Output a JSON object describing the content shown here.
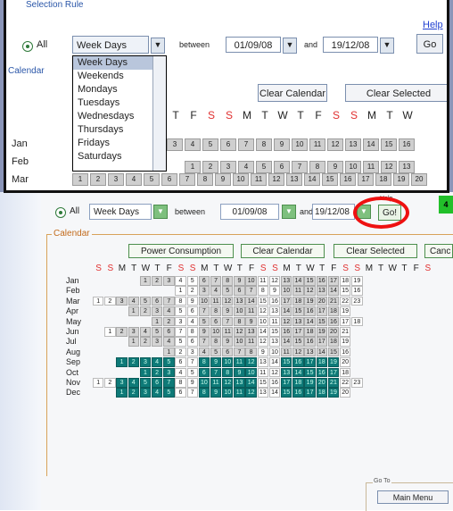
{
  "inset": {
    "title": "Selection Rule",
    "help": "Help",
    "all_label": "All",
    "select_value": "Week Days",
    "between": "between",
    "date_from": "01/09/08",
    "and": "and",
    "date_to": "19/12/08",
    "go": "Go",
    "calendar_label": "Calendar",
    "dropdown_options": [
      "Week Days",
      "Weekends",
      "Mondays",
      "Tuesdays",
      "Wednesdays",
      "Thursdays",
      "Fridays",
      "Saturdays"
    ],
    "clear_calendar": "Clear Calendar",
    "clear_selected": "Clear Selected",
    "day_header": [
      "T",
      "F",
      "S",
      "S",
      "M",
      "T",
      "W",
      "T",
      "F",
      "S",
      "S",
      "M",
      "T",
      "W"
    ],
    "months": [
      "Jan",
      "Feb",
      "Mar"
    ],
    "jan_cells": [
      "3",
      "4",
      "5",
      "6",
      "7",
      "8",
      "9",
      "10",
      "11",
      "12",
      "13",
      "14",
      "15",
      "16"
    ],
    "feb_cells": [
      "",
      "1",
      "2",
      "3",
      "4",
      "5",
      "6",
      "7",
      "8",
      "9",
      "10",
      "11",
      "12",
      "13"
    ],
    "mar_cells": [
      "1",
      "2",
      "3",
      "4",
      "5",
      "6",
      "7",
      "8",
      "9",
      "10",
      "11",
      "12",
      "13",
      "14",
      "15",
      "16",
      "17",
      "18",
      "19",
      "20"
    ]
  },
  "main": {
    "all_label": "All",
    "select_value": "Week Days",
    "between": "between",
    "date_from": "01/09/08",
    "and": "and",
    "date_to": "19/12/08",
    "help": "Help",
    "go": "Go!",
    "status": "4",
    "calendar_label": "Calendar",
    "btn_power": "Power Consumption",
    "btn_clear_cal": "Clear Calendar",
    "btn_clear_sel": "Clear Selected",
    "btn_cancel": "Canc",
    "goto_label": "Go To",
    "main_menu": "Main Menu"
  },
  "calendar": {
    "day_header": [
      "S",
      "S",
      "M",
      "T",
      "W",
      "T",
      "F",
      "S",
      "S",
      "M",
      "T",
      "W",
      "T",
      "F",
      "S",
      "S",
      "M",
      "T",
      "W",
      "T",
      "F",
      "S",
      "S",
      "M",
      "T",
      "W",
      "T",
      "F",
      "S"
    ],
    "weekend_cols": [
      0,
      1,
      7,
      8,
      14,
      15,
      21,
      22,
      28
    ],
    "months": [
      {
        "name": "Jan",
        "offset": 4,
        "start": 1,
        "count": 19,
        "teal_from": 0,
        "teal_to": 0
      },
      {
        "name": "Feb",
        "offset": 7,
        "start": 1,
        "count": 16,
        "teal_from": 0,
        "teal_to": 0
      },
      {
        "name": "Mar",
        "offset": 0,
        "start": 1,
        "count": 23,
        "teal_from": 0,
        "teal_to": 0
      },
      {
        "name": "Apr",
        "offset": 3,
        "start": 1,
        "count": 19,
        "teal_from": 0,
        "teal_to": 0
      },
      {
        "name": "May",
        "offset": 5,
        "start": 1,
        "count": 18,
        "teal_from": 0,
        "teal_to": 0
      },
      {
        "name": "Jun",
        "offset": 1,
        "start": 1,
        "count": 21,
        "teal_from": 0,
        "teal_to": 0
      },
      {
        "name": "Jul",
        "offset": 3,
        "start": 1,
        "count": 19,
        "teal_from": 0,
        "teal_to": 0
      },
      {
        "name": "Aug",
        "offset": 6,
        "start": 1,
        "count": 16,
        "teal_from": 0,
        "teal_to": 0
      },
      {
        "name": "Sep",
        "offset": 2,
        "start": 1,
        "count": 20,
        "teal_from": 1,
        "teal_to": 20
      },
      {
        "name": "Oct",
        "offset": 4,
        "start": 1,
        "count": 18,
        "teal_from": 1,
        "teal_to": 18
      },
      {
        "name": "Nov",
        "offset": 0,
        "start": 1,
        "count": 23,
        "teal_from": 3,
        "teal_to": 22
      },
      {
        "name": "Dec",
        "offset": 2,
        "start": 1,
        "count": 20,
        "teal_from": 1,
        "teal_to": 19
      }
    ]
  }
}
